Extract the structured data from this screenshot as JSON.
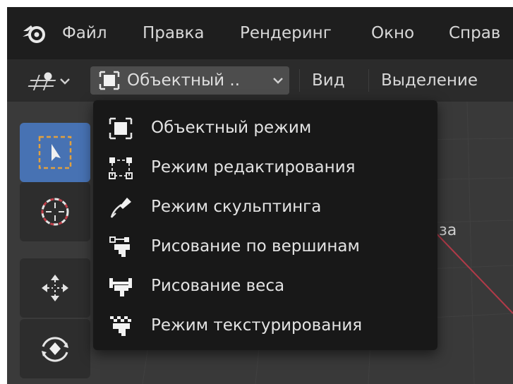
{
  "menubar": {
    "logo_icon": "blender-logo-icon",
    "items": [
      {
        "label": "Файл"
      },
      {
        "label": "Правка"
      },
      {
        "label": "Рендеринг"
      },
      {
        "label": "Окно"
      },
      {
        "label": "Справ"
      }
    ]
  },
  "header": {
    "transform_icon": "transform-pivot-icon",
    "mode_select": {
      "icon": "object-mode-icon",
      "value": "Объектный ..",
      "chevron_icon": "chevron-down-icon"
    },
    "menus": [
      {
        "label": "Вид"
      },
      {
        "label": "Выделение"
      }
    ]
  },
  "toolbar": {
    "tools": [
      {
        "icon": "select-box-icon",
        "active": true
      },
      {
        "icon": "cursor-icon",
        "active": false
      },
      {
        "icon": "move-icon",
        "active": false
      },
      {
        "icon": "rotate-icon",
        "active": false
      }
    ]
  },
  "viewport": {
    "partial_label": "за"
  },
  "mode_dropdown": {
    "items": [
      {
        "label": "Объектный режим",
        "icon": "object-mode-icon"
      },
      {
        "label": "Режим редактирования",
        "icon": "edit-mode-icon"
      },
      {
        "label": "Режим скульптинга",
        "icon": "sculpt-mode-icon"
      },
      {
        "label": "Рисование по вершинам",
        "icon": "vertex-paint-icon"
      },
      {
        "label": "Рисование веса",
        "icon": "weight-paint-icon"
      },
      {
        "label": "Режим текстурирования",
        "icon": "texture-paint-icon"
      }
    ]
  },
  "colors": {
    "menubar_bg": "#1e1e1e",
    "header_bg": "#2b2b2b",
    "active_tool": "#4772b3",
    "dropdown_bg": "#181818",
    "axis_red": "#b03a48"
  }
}
